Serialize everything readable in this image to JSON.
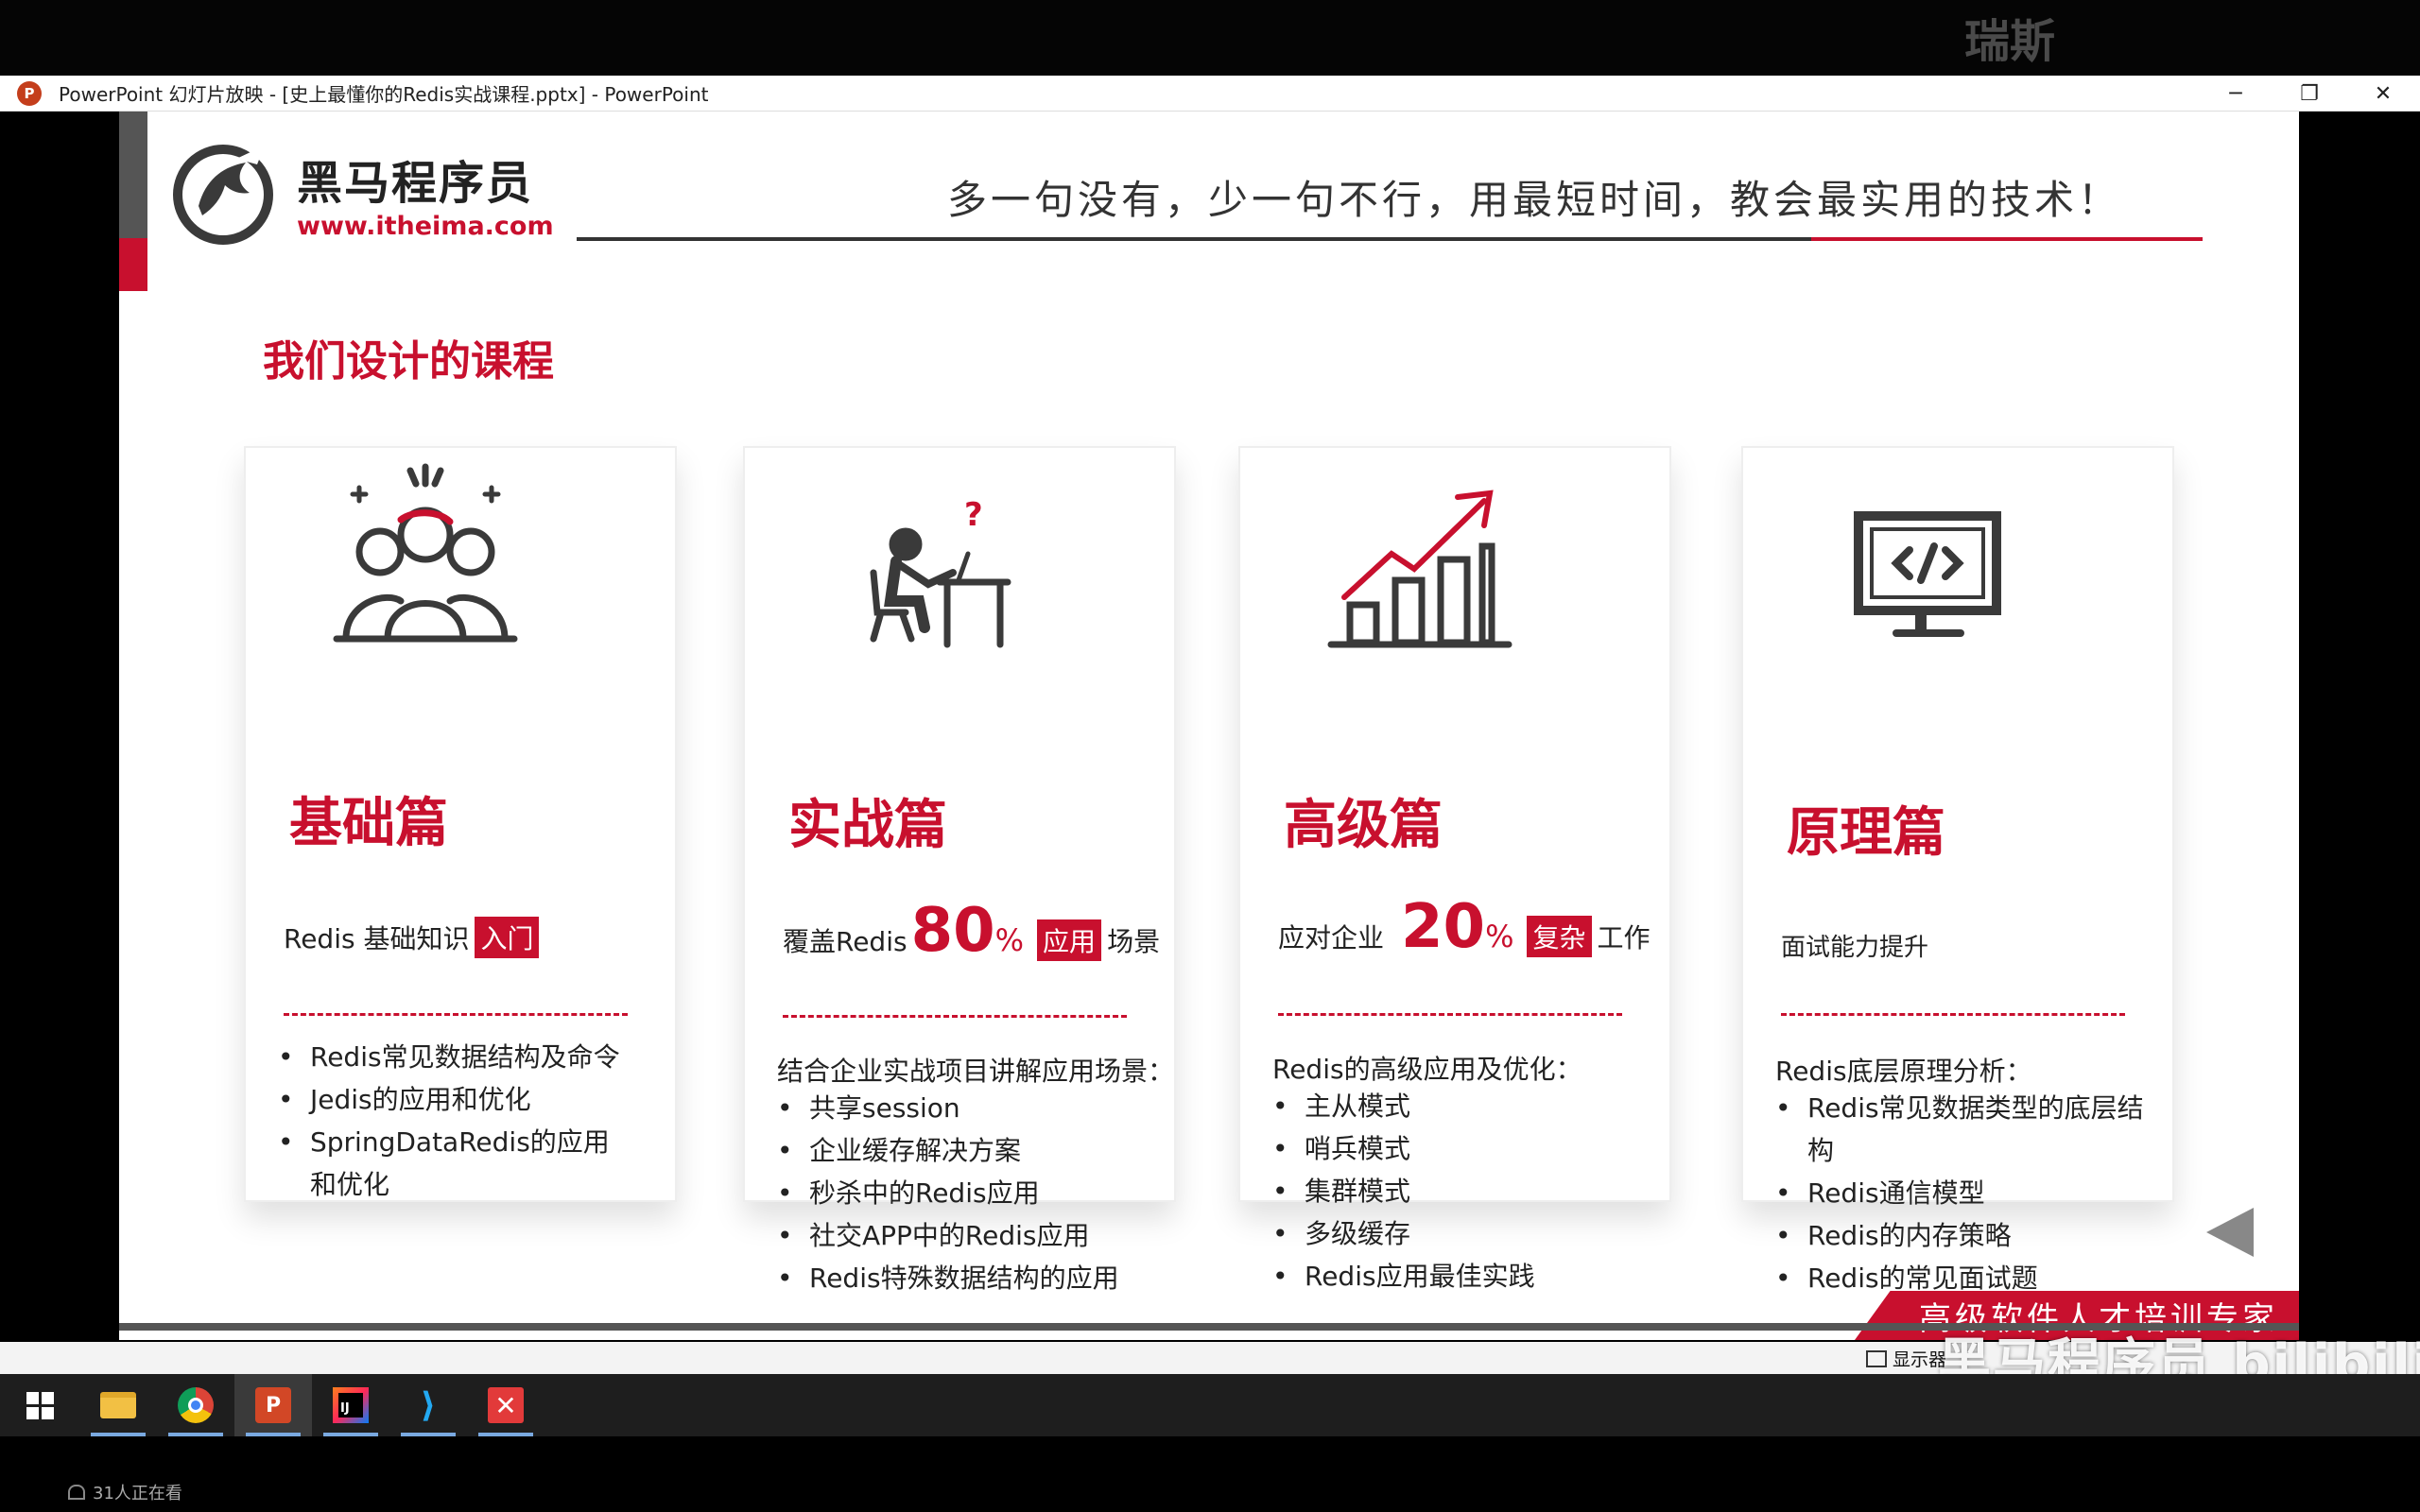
{
  "top_watermark": "瑞斯",
  "window": {
    "title": "PowerPoint 幻灯片放映 - [史上最懂你的Redis实战课程.pptx] - PowerPoint",
    "app_icon": "P",
    "minimize": "─",
    "restore": "❐",
    "close": "✕"
  },
  "slide": {
    "logo_cn": "黑马程序员",
    "logo_en": "www.itheima.com",
    "slogan": "多一句没有，少一句不行，用最短时间，教会最实用的技术！",
    "section_title": "我们设计的课程",
    "cards": [
      {
        "icon": "team-icon",
        "title": "基础篇",
        "sub_prefix": "Redis 基础知识",
        "sub_num": "",
        "sub_pct": "",
        "sub_tag": "入门",
        "sub_suffix": "",
        "lead": "",
        "items": [
          "Redis常见数据结构及命令",
          "Jedis的应用和优化",
          "SpringDataRedis的应用和优化"
        ]
      },
      {
        "icon": "developer-desk-icon",
        "title": "实战篇",
        "sub_prefix": "覆盖Redis",
        "sub_num": "80",
        "sub_pct": "%",
        "sub_tag": "应用",
        "sub_suffix": "场景",
        "lead": "结合企业实战项目讲解应用场景：",
        "items": [
          "共享session",
          "企业缓存解决方案",
          "秒杀中的Redis应用",
          "社交APP中的Redis应用",
          "Redis特殊数据结构的应用"
        ]
      },
      {
        "icon": "growth-chart-icon",
        "title": "高级篇",
        "sub_prefix": "应对企业",
        "sub_num": "20",
        "sub_pct": "%",
        "sub_tag": "复杂",
        "sub_suffix": "工作",
        "lead": "Redis的高级应用及优化：",
        "items": [
          "主从模式",
          "哨兵模式",
          "集群模式",
          "多级缓存",
          "Redis应用最佳实践"
        ]
      },
      {
        "icon": "code-monitor-icon",
        "title": "原理篇",
        "sub_prefix": "面试能力提升",
        "sub_num": "",
        "sub_pct": "",
        "sub_tag": "",
        "sub_suffix": "",
        "lead": "Redis底层原理分析：",
        "items": [
          "Redis常见数据类型的底层结构",
          "Redis通信模型",
          "Redis的内存策略",
          "Redis的常见面试题"
        ]
      }
    ],
    "footer_text": "高级软件人才培训专家"
  },
  "status_bar": {
    "display_label": "显示器",
    "video_watermark": "黑马程序员 bilibili"
  },
  "taskbar": {
    "items": [
      "start",
      "file-explorer",
      "chrome",
      "powerpoint",
      "intellij-idea",
      "vscode",
      "xmind"
    ],
    "ppt_label": "P",
    "idea_label": "IJ",
    "vscode_label": "⟩",
    "x_label": "✕"
  },
  "viewers": "31人正在看",
  "colors": {
    "brand_red": "#c8102e",
    "icon_gray": "#3a3a3a"
  }
}
